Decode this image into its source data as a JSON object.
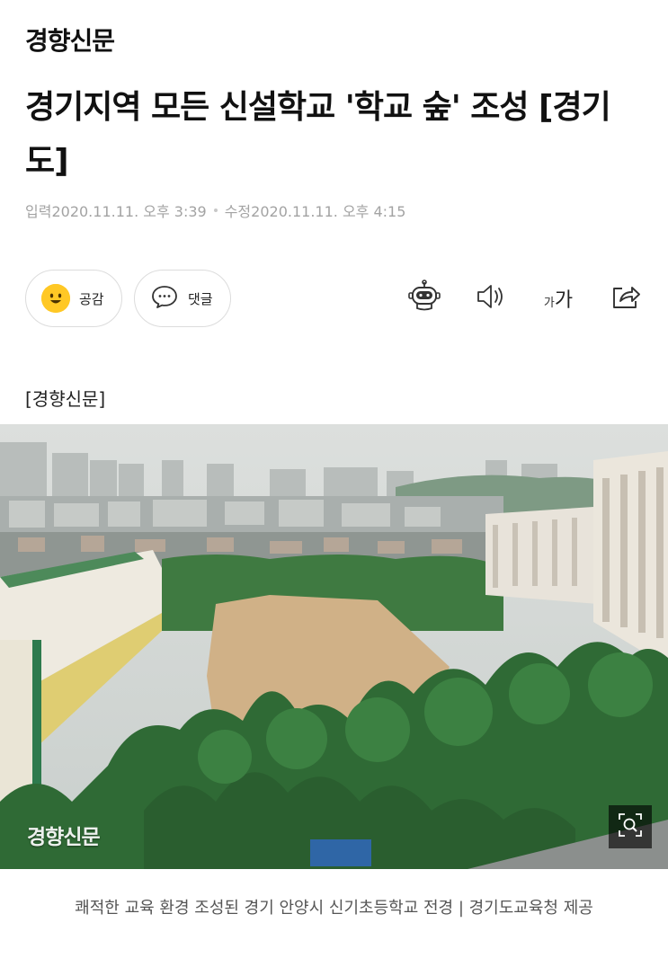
{
  "brand": "경향신문",
  "headline": "경기지역 모든 신설학교 '학교 숲' 조성 [경기도]",
  "meta": {
    "input_label": "입력",
    "input_time": "2020.11.11. 오후 3:39",
    "edit_label": "수정",
    "edit_time": "2020.11.11. 오후 4:15"
  },
  "reactions": {
    "like_label": "공감",
    "comment_label": "댓글"
  },
  "toolbar": {
    "font_small": "가",
    "font_big": "가",
    "icons": [
      "robot-icon",
      "speaker-icon",
      "font-size-icon",
      "share-icon"
    ]
  },
  "source_label": "[경향신문]",
  "photo": {
    "watermark": "경향신문",
    "zoom_icon": "zoom-icon"
  },
  "caption": "쾌적한 교육 환경 조성된 경기 안양시 신기초등학교 전경 | 경기도교육청 제공",
  "colors": {
    "emoji_yellow": "#ffc825",
    "meta_gray": "#a3a3a3",
    "caption_gray": "#555555"
  }
}
